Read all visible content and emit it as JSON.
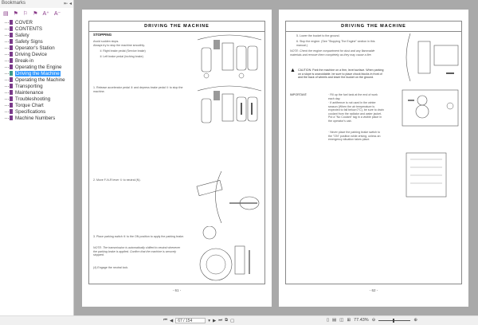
{
  "sidebar": {
    "title": "Bookmarks",
    "items": [
      "COVER",
      "CONTENTS",
      "Safety",
      "Safety Signs",
      "Operator's Station",
      "Driving Device",
      "Break-in",
      "Operating the Engine",
      "Driving the Machine",
      "Operating the Machine",
      "Transporting",
      "Maintenance",
      "Troubleshooting",
      "Torque Chart",
      "Specifications",
      "Machine Numbers"
    ],
    "selected": 8
  },
  "page1": {
    "header": "DRIVING THE MACHINE",
    "section": "STOPPING",
    "intro1": "Avoid sudden stops.",
    "intro2": "Always try to stop the machine smoothly.",
    "item1": "① Right brake pedal (Service brake)",
    "item2": "② Left brake pedal (inching brake)",
    "step1": "1. Release accelerator pedal ③ and depress brake pedal ④ to stop the machine.",
    "step2": "2. Move F-N-R lever ⑤ to neutral (N).",
    "step3": "3. Place parking switch ⑥ to the ON position to apply the parking brake.",
    "note": "NOTE: The transmission is automatically shifted to neutral whenever the parking brake is applied. Confirm that the machine is securely stopped.",
    "step4": "(4) Engage the neutral lock.",
    "page_number": "- 61 -"
  },
  "page2": {
    "header": "DRIVING THE MACHINE",
    "step5": "5. Lower the bucket to the ground.",
    "step6": "6. Stop the engine. (See \"Stopping The Engine\" section in this manual.)",
    "note": "NOTE: Check the engine compartment for dust and any flammable materials and remove them completely as they may cause a fire.",
    "caution": "CAUTION: Park the machine on a firm, level surface. When parking on a slope is unavoidable, be sure to place chock blocks in front of and the back of wheels and lower the bucket on the ground.",
    "important_label": "IMPORTANT:",
    "important1": "· Fill up the fuel tank at the end of work each day.",
    "important2": "· If antifreeze is not used in the winter season (When the air temperature is expected to fall below 0°C), be sure to drain coolant from the radiator and water jacket. Put a \"No Coolant\" tag in a visible place in the operator's cab.",
    "important3": "· Never place the parking brake switch to the \"ON\" position while driving, unless an emergency situation takes place.",
    "page_number": "- 62 -"
  },
  "status": {
    "page_input": "67 / 154",
    "zoom": "77.43%"
  }
}
